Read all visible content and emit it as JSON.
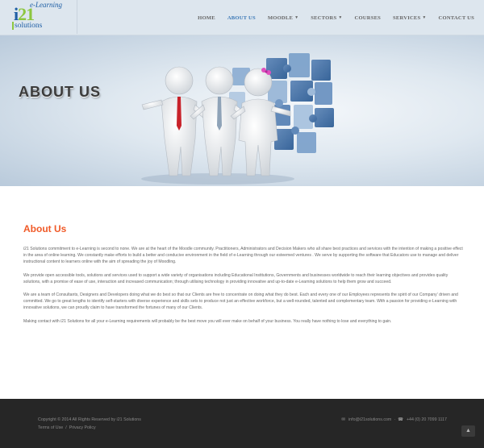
{
  "logo": {
    "top": "e-Learning",
    "num_a": "i",
    "num_b": "21",
    "bottom": "solutions"
  },
  "nav": [
    {
      "label": "HOME",
      "caret": false,
      "active": false
    },
    {
      "label": "ABOUT US",
      "caret": false,
      "active": true
    },
    {
      "label": "MOODLE",
      "caret": true,
      "active": false
    },
    {
      "label": "SECTORS",
      "caret": true,
      "active": false
    },
    {
      "label": "COURSES",
      "caret": false,
      "active": false
    },
    {
      "label": "SERVICES",
      "caret": true,
      "active": false
    },
    {
      "label": "CONTACT US",
      "caret": false,
      "active": false
    }
  ],
  "hero": {
    "title": "ABOUT US"
  },
  "content": {
    "heading": "About Us",
    "paragraphs": [
      "i21 Solutions commitment to e-Learning is second to none. We are at the heart of the Moodle community. Practitioners, Administrators and Decision Makers who all share best practices and services with the intention of making a positive effect in the area of online learning. We constantly make efforts to build a better and conducive environment in the field of e-Learning through our esteemed ventures . We serve by supporting the software that Educators use to manage and deliver instructional content to learners online with the aim of spreading the joy of Moodling.",
      "We provide open accessible tools, solutions and services used to support a wide variety of organisations including Educational Institutions, Governments and businesses worldwide to reach their learning objectives and provides quality solutions, with a promise of ease of use, interaction and increased communication; through utilising technology in providing innovative and up-to-date e-Learning solutions to help them grow and succeed.",
      "We are a team of Consultants, Designers and Developers doing what we do best so that our Clients are free to concentrate on doing what they do best. Each and every one of our Employees represents the spirit of our Company' driven and committed. We go to great lengths to identify self-starters with diverse experience and skills sets to produce not just an effective workforce, but a well-rounded, talented and complementary team. With a passion for providing e-Learning with innovative solutions, we can proudly claim to have transformed the fortunes of many of our Clients.",
      "Making contact with i21 Solutions for all your e-Learning requirements will probably be the best move you will ever make on behalf of your business. You really have nothing to lose and everything to gain."
    ]
  },
  "footer": {
    "copyright": "Copyright © 2014 All Rights Reserved by i21 Solutions",
    "terms": "Terms of Use",
    "separator": "/",
    "privacy": "Privacy Policy",
    "email": "info@i21solutions.com",
    "divider": "·",
    "phone": "+44 (0) 20 7099 1117"
  },
  "icons": {
    "email": "envelope-icon",
    "phone": "phone-icon",
    "top": "chevron-up-icon"
  },
  "colors": {
    "accent": "#f05a28",
    "nav_active": "#3b78b6",
    "footer_bg": "#262626",
    "logo_blue": "#1f5fa5",
    "logo_green": "#8cc63f"
  }
}
